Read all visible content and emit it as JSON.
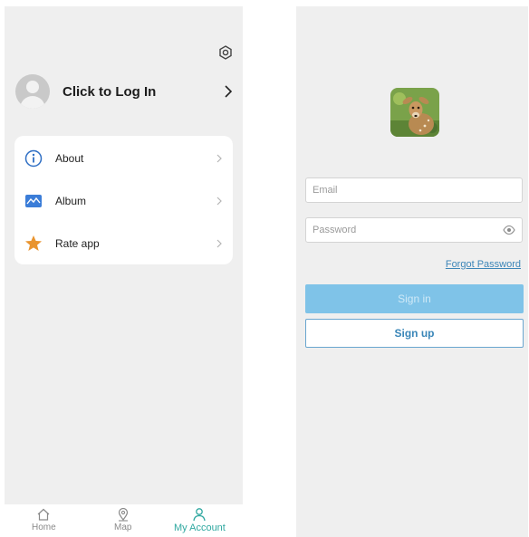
{
  "account_screen": {
    "login": {
      "label": "Click to Log In"
    },
    "menu": [
      {
        "label": "About",
        "icon": "info-icon"
      },
      {
        "label": "Album",
        "icon": "image-icon"
      },
      {
        "label": "Rate app",
        "icon": "star-icon"
      }
    ],
    "bottom_nav": [
      {
        "label": "Home",
        "icon": "home-icon"
      },
      {
        "label": "Map",
        "icon": "map-pin-icon"
      },
      {
        "label": "My Account",
        "icon": "user-icon",
        "active": true
      }
    ]
  },
  "login_screen": {
    "email": {
      "placeholder": "Email"
    },
    "password": {
      "placeholder": "Password"
    },
    "forgot_label": "Forgot Password",
    "sign_in_label": "Sign in",
    "sign_up_label": "Sign up"
  },
  "colors": {
    "accent": "#2fa8a0",
    "primary_button": "#7fc3e8",
    "link": "#3d86b8",
    "screen_background": "#efefef"
  }
}
